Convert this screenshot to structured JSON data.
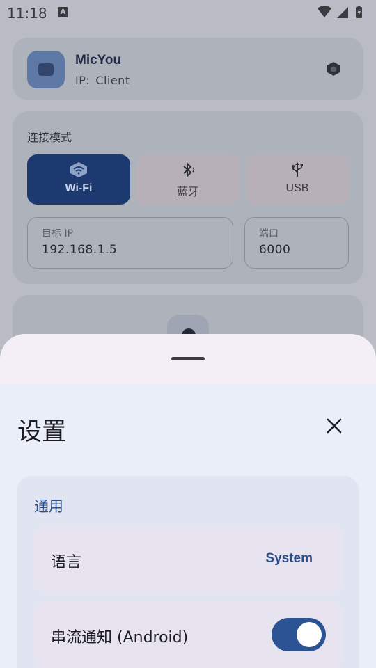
{
  "status_bar": {
    "time": "11:18",
    "notification_icon": "A",
    "icons": [
      "wifi-icon",
      "signal-icon",
      "battery-icon"
    ]
  },
  "app_header": {
    "name": "MicYou",
    "ip_label": "IP:",
    "ip_value": "Client",
    "icons": [
      "app-logo-icon",
      "settings-hex-icon"
    ]
  },
  "connection": {
    "title": "连接模式",
    "modes": [
      {
        "label": "Wi-Fi",
        "icon": "wifi-router-icon",
        "selected": true
      },
      {
        "label": "蓝牙",
        "icon": "bluetooth-icon",
        "selected": false
      },
      {
        "label": "USB",
        "icon": "usb-icon",
        "selected": false
      }
    ],
    "target_ip": {
      "label": "目标 IP",
      "value": "192.168.1.5"
    },
    "port": {
      "label": "端口",
      "value": "6000"
    }
  },
  "settings_sheet": {
    "title": "设置",
    "close_icon": "close-icon",
    "general_section": {
      "title": "通用",
      "language": {
        "label": "语言",
        "value": "System"
      },
      "stream_notification": {
        "label": "串流通知 (Android)",
        "enabled": true
      }
    }
  },
  "colors": {
    "accent": "#2c5394",
    "active_mode": "#1c3a70",
    "sheet_background": "#e9eef9",
    "sheet_header": "#f4eff7",
    "section_title": "#2a5291"
  }
}
